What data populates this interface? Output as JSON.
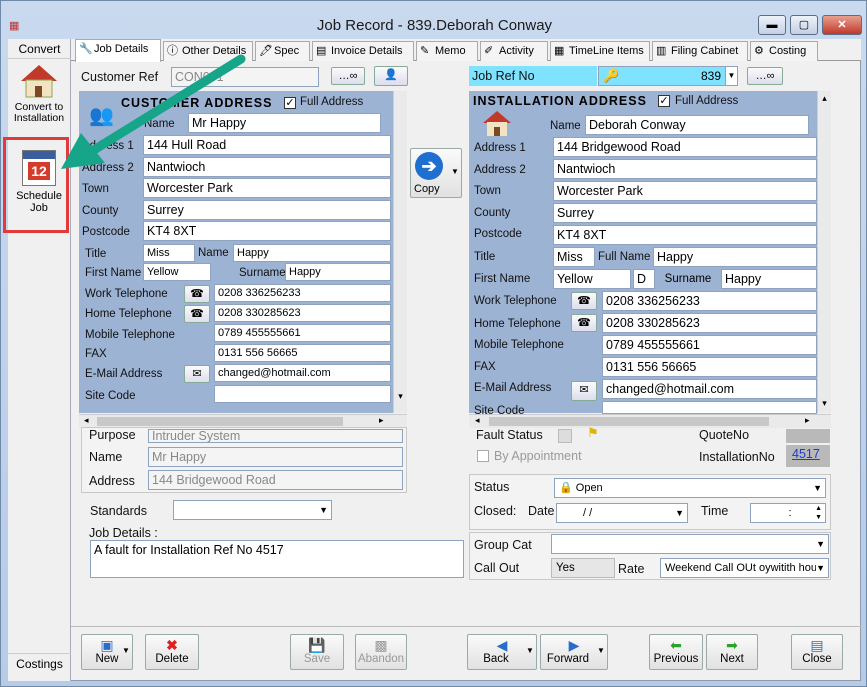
{
  "window": {
    "title": "Job Record - 839.Deborah Conway",
    "min": "▬",
    "max": "▢",
    "close": "✕"
  },
  "left": {
    "convert_label": "Convert",
    "convert_to_installation": "Convert to Installation",
    "schedule_job": "Schedule Job",
    "calendar_day": "12",
    "costings": "Costings"
  },
  "tabs": [
    {
      "label": "Job Details",
      "icon": "wrench-icon"
    },
    {
      "label": "Other Details",
      "icon": "info-icon"
    },
    {
      "label": "Spec",
      "icon": "document-icon"
    },
    {
      "label": "Invoice Details",
      "icon": "invoice-icon"
    },
    {
      "label": "Memo",
      "icon": "memo-icon"
    },
    {
      "label": "Activity",
      "icon": "activity-icon"
    },
    {
      "label": "TimeLine Items",
      "icon": "timeline-icon"
    },
    {
      "label": "Filing Cabinet",
      "icon": "cabinet-icon"
    },
    {
      "label": "Costing",
      "icon": "costing-icon"
    }
  ],
  "customer": {
    "ref_label": "Customer Ref",
    "ref_value": "CON001",
    "header": "CUSTOMER  ADDRESS",
    "full_address_label": "Full Address",
    "name_label": "Name",
    "name": "Mr Happy",
    "address1_label": "Address 1",
    "address1": "144 Hull Road",
    "address2_label": "Address 2",
    "address2": "Nantwioch",
    "town_label": "Town",
    "town": "Worcester Park",
    "county_label": "County",
    "county": "Surrey",
    "postcode_label": "Postcode",
    "postcode": "KT4 8XT",
    "title_label": "Title",
    "title": "Miss",
    "name2_label": "Name",
    "name2": "Happy",
    "firstname_label": "First Name",
    "firstname": "Yellow",
    "surname_label": "Surname",
    "surname": "Happy",
    "work_tel_label": "Work Telephone",
    "work_tel": "0208 336256233",
    "home_tel_label": "Home Telephone",
    "home_tel": "0208 330285623",
    "mobile_label": "Mobile Telephone",
    "mobile": "0789 455555661",
    "fax_label": "FAX",
    "fax": "0131 556 56665",
    "email_label": "E-Mail Address",
    "email": "changed@hotmail.com",
    "site_code_label": "Site Code"
  },
  "copy_label": "Copy",
  "installation": {
    "jobref_label": "Job Ref No",
    "jobref": "839",
    "header": "INSTALLATION  ADDRESS",
    "full_address_label": "Full Address",
    "name_label": "Name",
    "name": "Deborah Conway",
    "address1_label": "Address 1",
    "address1": "144 Bridgewood Road",
    "address2_label": "Address 2",
    "address2": "Nantwioch",
    "town_label": "Town",
    "town": "Worcester Park",
    "county_label": "County",
    "county": "Surrey",
    "postcode_label": "Postcode",
    "postcode": "KT4 8XT",
    "title_label": "Title",
    "title": "Miss",
    "fullname_label": "Full Name",
    "fullname": "Happy",
    "firstname_label": "First Name",
    "firstname": "Yellow",
    "initial": "D",
    "surname_label": "Surname",
    "surname": "Happy",
    "work_tel_label": "Work Telephone",
    "work_tel": "0208 336256233",
    "home_tel_label": "Home Telephone",
    "home_tel": "0208 330285623",
    "mobile_label": "Mobile Telephone",
    "mobile": "0789 455555661",
    "fax_label": "FAX",
    "fax": "0131 556 56665",
    "email_label": "E-Mail Address",
    "email": "changed@hotmail.com",
    "site_code_label": "Site Code"
  },
  "job": {
    "purpose_label": "Purpose",
    "purpose": "Intruder System",
    "name_label": "Name",
    "name": "Mr Happy",
    "address_label": "Address",
    "address": "144 Bridgewood Road",
    "fault_status_label": "Fault Status",
    "by_appointment_label": "By Appointment",
    "quoteno_label": "QuoteNo",
    "installationno_label": "InstallationNo",
    "installationno": "4517",
    "standards_label": "Standards",
    "job_details_label": "Job Details :",
    "job_details": "A fault for Installation Ref No 4517",
    "status_label": "Status",
    "status": "Open",
    "closed_label": "Closed:",
    "date_label": "Date",
    "date_value": "/      /",
    "time_label": "Time",
    "time_value": ":",
    "group_cat_label": "Group Cat",
    "call_out_label": "Call Out",
    "call_out": "Yes",
    "rate_label": "Rate",
    "rate": "Weekend Call OUt oywitith hou"
  },
  "toolbar": {
    "new": "New",
    "delete": "Delete",
    "save": "Save",
    "abandon": "Abandon",
    "back": "Back",
    "forward": "Forward",
    "previous": "Previous",
    "next": "Next",
    "close": "Close"
  },
  "colors": {
    "panel": "#9db3d3",
    "jobref_bg": "#7fe3ff",
    "annotation_arrow": "#17a589",
    "highlight_box": "#e03a3a"
  }
}
